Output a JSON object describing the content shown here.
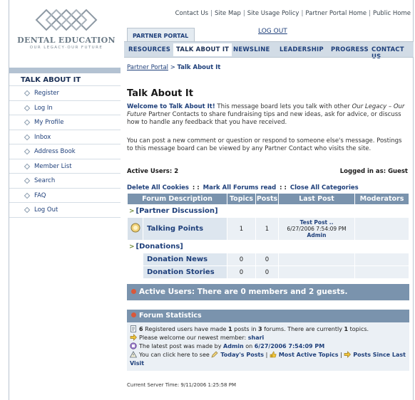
{
  "logo": {
    "name": "DENTAL EDUCATION",
    "tagline": "OUR LEGACY·OUR FUTURE"
  },
  "top_links": [
    "Contact Us",
    "Site Map",
    "Site Usage Policy",
    "Partner Portal Home",
    "Public Home"
  ],
  "logout": "LOG OUT",
  "portal_tab": "PARTNER PORTAL",
  "nav": [
    "RESOURCES",
    "TALK ABOUT IT",
    "NEWSLINE",
    "LEADERSHIP",
    "PROGRESS",
    "CONTACT US"
  ],
  "nav_active": "TALK ABOUT IT",
  "sidebar": {
    "title": "TALK ABOUT IT",
    "items": [
      "Register",
      "Log In",
      "My Profile",
      "Inbox",
      "Address Book",
      "Member List",
      "Search",
      "FAQ",
      "Log Out"
    ]
  },
  "breadcrumb": {
    "link": "Partner Portal",
    "sep": " > ",
    "current": "Talk About It"
  },
  "page_title": "Talk About It",
  "intro": {
    "lead": "Welcome to Talk About It!",
    "text1": " This message board lets you talk with other ",
    "italic": "Our Legacy – Our Future",
    "text2": " Partner Contacts to share fundraising tips and new ideas, ask for advice, or discuss how to handle any feedback that you have received.",
    "para2": "You can post a new comment or question or respond to someone else's message. Postings to this message board can be viewed by any Partner Contact who visits the site."
  },
  "active_users": "Active Users: 2",
  "logged_in": "Logged in as: Guest",
  "actions": [
    "Delete All Cookies",
    "Mark All Forums read",
    "Close All Categories"
  ],
  "actions_sep": " : : ",
  "table": {
    "headers": [
      "Forum Description",
      "Topics",
      "Posts",
      "Last Post",
      "Moderators"
    ],
    "categories": [
      {
        "name": "[Partner Discussion]",
        "forums": [
          {
            "name": "Talking Points",
            "topics": "1",
            "posts": "1",
            "last_title": "Test Post ..",
            "last_date": "6/27/2006 7:54:09 PM",
            "last_by": "Admin",
            "icon": "forum-bubble-icon"
          }
        ]
      },
      {
        "name": "[Donations]",
        "forums": [
          {
            "name": "Donation News",
            "topics": "0",
            "posts": "0"
          },
          {
            "name": "Donation Stories",
            "topics": "0",
            "posts": "0"
          }
        ]
      }
    ]
  },
  "active_box": "Active Users: There are 0 members and 2 guests.",
  "stats": {
    "title": "Forum Statistics",
    "line1": {
      "users": "6",
      "a": " Registered users have made ",
      "posts": "1",
      "b": " posts in ",
      "forums": "3",
      "c": " forums. There are currently ",
      "topics": "1",
      "d": " topics."
    },
    "line2": {
      "text": "Please welcome our newest member: ",
      "member": "shari"
    },
    "line3": {
      "text": "The latest post was made by ",
      "by": "Admin",
      "on": " on ",
      "date": "6/27/2006 7:54:09 PM"
    },
    "line4": {
      "text": "You can click here to see ",
      "today": "Today's Posts",
      "active": "Most Active Topics",
      "since": "Posts Since Last Visit"
    }
  },
  "server_time": "Current Server Time: 9/11/2006 1:25:58 PM",
  "colors": {
    "nav_bar": "#d2dce6",
    "table_header": "#7a93ad",
    "link": "#1e3f7a",
    "status_dot": "#d9583a"
  }
}
